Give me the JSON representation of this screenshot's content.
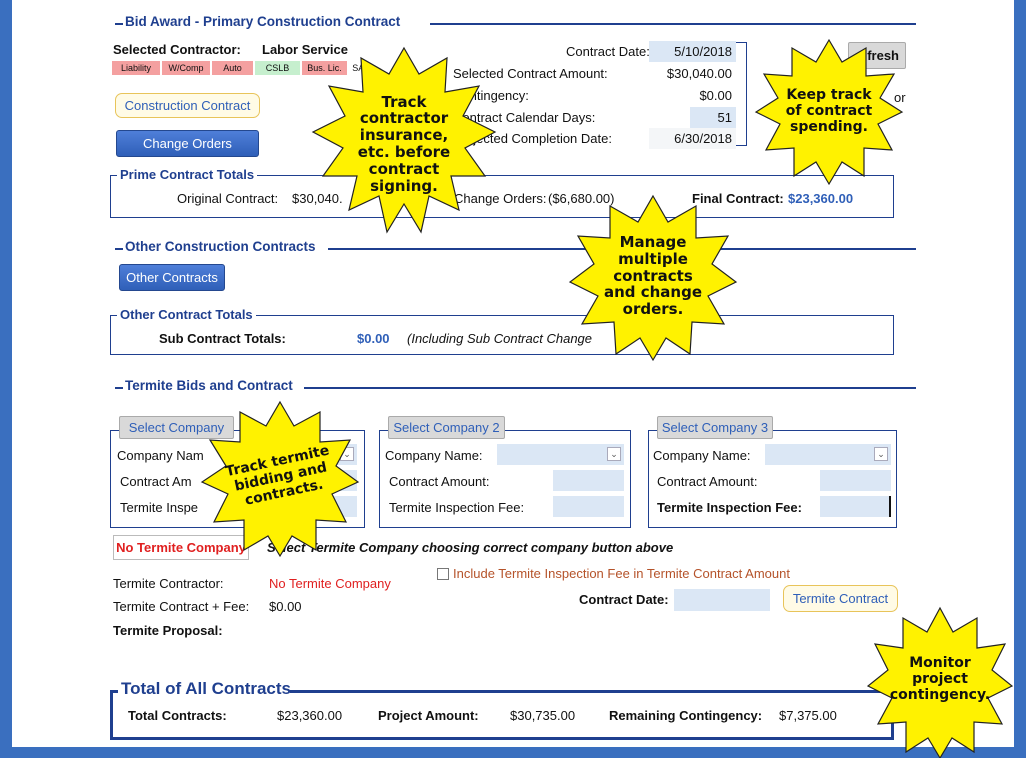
{
  "bid_award": {
    "title": "Bid Award - Primary Construction Contract",
    "selected_contractor_label": "Selected Contractor:",
    "selected_contractor_value": "Labor Service",
    "chips": [
      {
        "label": "Liability",
        "color": "#f4a0a0"
      },
      {
        "label": "W/Comp",
        "color": "#f4a0a0"
      },
      {
        "label": "Auto",
        "color": "#f4a0a0"
      },
      {
        "label": "CSLB",
        "color": "#c6efce"
      },
      {
        "label": "Bus. Lic.",
        "color": "#f4a0a0"
      },
      {
        "label": "SAM",
        "color": "#ffffff"
      }
    ],
    "construction_contract_button": "Construction Contract",
    "change_orders_button": "Change Orders",
    "refresh_button": "fresh",
    "contract_date_label": "Contract Date:",
    "contract_date_value": "5/10/2018",
    "selected_amount_label": "Selected Contract Amount:",
    "selected_amount_value": "$30,040.00",
    "contingency_label": "Contingency:",
    "contingency_value": "$0.00",
    "calendar_days_label": "Contract Calendar Days:",
    "calendar_days_value": "51",
    "completion_label": "Projected Completion Date:",
    "completion_value": "6/30/2018",
    "side_letter": "or"
  },
  "prime_totals": {
    "title": "Prime Contract Totals",
    "original_label": "Original Contract:",
    "original_value": "$30,040.",
    "change_orders_label": "Change Orders:",
    "change_orders_value": "($6,680.00)",
    "final_label": "Final Contract:",
    "final_value": "$23,360.00"
  },
  "other_construction": {
    "title": "Other Construction Contracts",
    "button": "Other Contracts",
    "totals_title": "Other Contract Totals",
    "sub_label": "Sub Contract Totals:",
    "sub_value": "$0.00",
    "sub_note": "(Including Sub Contract Change"
  },
  "termite": {
    "title": "Termite Bids and Contract",
    "companies": [
      {
        "button": "Select Company",
        "name_label": "Company Nam",
        "amount_label": "Contract Am",
        "fee_label": "Termite Inspe"
      },
      {
        "button": "Select Company 2",
        "name_label": "Company Name:",
        "amount_label": "Contract Amount:",
        "fee_label": "Termite Inspection Fee:"
      },
      {
        "button": "Select Company 3",
        "name_label": "Company Name:",
        "amount_label": "Contract Amount:",
        "fee_label": "Termite Inspection Fee:"
      }
    ],
    "no_company_badge": "No Termite Company",
    "instruction": "Select Termite Company choosing correct company  button above",
    "contractor_label": "Termite Contractor:",
    "contractor_value": "No Termite Company",
    "include_fee_label": "Include Termite Inspection Fee in Termite Contract Amount",
    "contract_fee_label": "Termite Contract + Fee:",
    "contract_fee_value": "$0.00",
    "contract_date_label": "Contract Date:",
    "contract_button": "Termite Contract",
    "proposal_label": "Termite Proposal:"
  },
  "totals": {
    "title": "Total of All Contracts",
    "total_label": "Total Contracts:",
    "total_value": "$23,360.00",
    "project_label": "Project Amount:",
    "project_value": "$30,735.00",
    "remaining_label": "Remaining Contingency:",
    "remaining_value": "$7,375.00"
  },
  "callouts": {
    "insurance": "Track contractor insurance, etc. before contract signing.",
    "spending": "Keep track of contract spending.",
    "multiple": "Manage multiple contracts and change orders.",
    "termite": "Track termite bidding and contracts.",
    "contingency": "Monitor project contingency."
  },
  "colors": {
    "frame_blue": "#3a6fbf",
    "accent_blue": "#1f3f8f",
    "callout_yellow": "#fff200",
    "red_text": "#e02020"
  }
}
